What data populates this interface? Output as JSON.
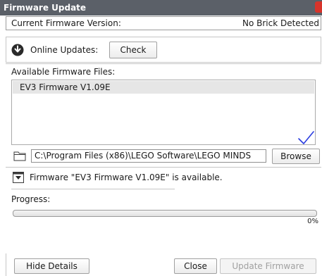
{
  "window": {
    "title": "Firmware Update"
  },
  "firmware": {
    "current_label": "Current Firmware Version:",
    "current_value": "No Brick Detected"
  },
  "online": {
    "label": "Online Updates:",
    "check_button": "Check"
  },
  "available": {
    "label": "Available Firmware Files:",
    "files": [
      "EV3 Firmware V1.09E"
    ]
  },
  "path": {
    "value": "C:\\Program Files (x86)\\LEGO Software\\LEGO MINDS",
    "browse_button": "Browse"
  },
  "details": {
    "message": "Firmware \"EV3 Firmware V1.09E\" is available."
  },
  "progress": {
    "label": "Progress:",
    "percent_text": "0%",
    "fraction": 0
  },
  "footer": {
    "hide_details": "Hide Details",
    "close": "Close",
    "update": "Update Firmware"
  },
  "colors": {
    "titlebar": "#5b6068",
    "close": "#d8342b",
    "checkmark": "#2b3de0"
  },
  "icons": {
    "online": "download-circle-icon",
    "folder": "folder-icon",
    "expand": "expand-toggle-icon"
  }
}
